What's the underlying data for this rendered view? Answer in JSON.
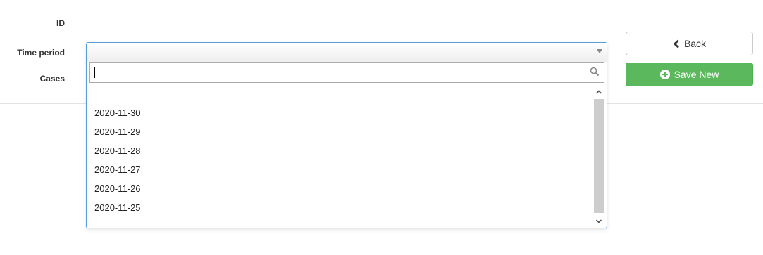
{
  "form": {
    "labels": {
      "id": "ID",
      "time_period": "Time period",
      "cases": "Cases"
    }
  },
  "dropdown": {
    "search_value": "",
    "options": [
      "2020-11-30",
      "2020-11-29",
      "2020-11-28",
      "2020-11-27",
      "2020-11-26",
      "2020-11-25"
    ]
  },
  "buttons": {
    "back_label": "Back",
    "save_new_label": "Save New"
  },
  "colors": {
    "save_button": "#5cb85c",
    "focus_border": "#5b9dd9"
  },
  "icons": {
    "back": "chevron-left-icon",
    "save_new": "plus-circle-icon",
    "search": "search-icon"
  }
}
